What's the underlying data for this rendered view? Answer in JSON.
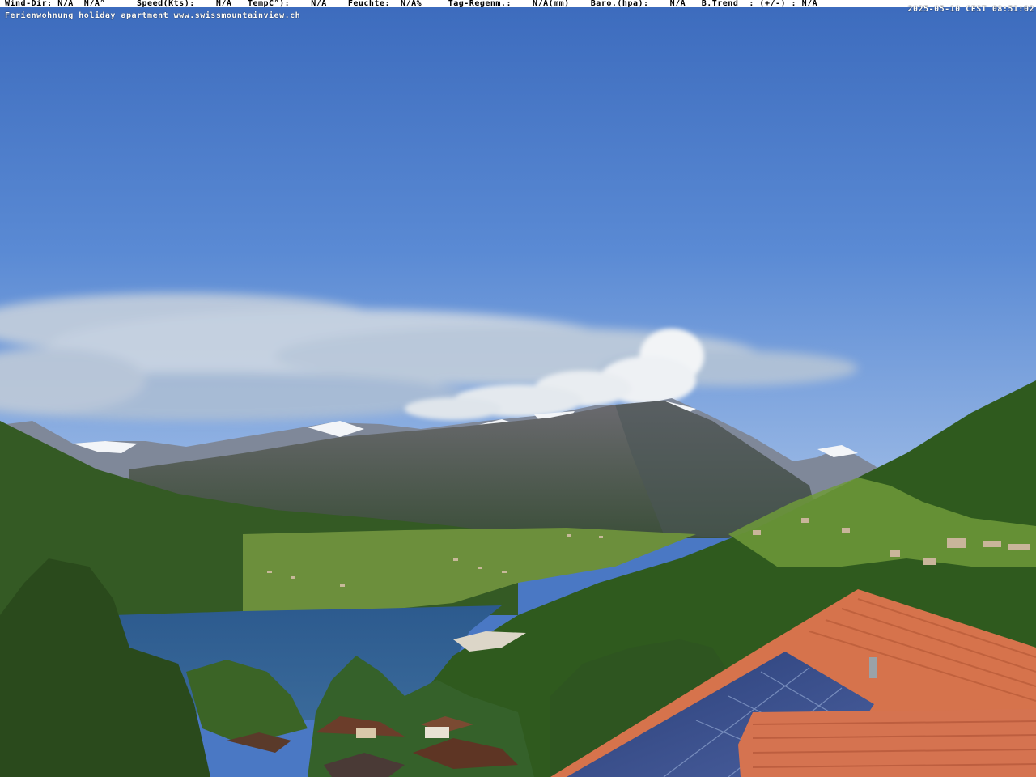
{
  "overlay": {
    "weather_line": "Wind-Dir: N/A  N/A°      Speed(Kts):    N/A   TempC°):    N/A    Feuchte:  N/A%     Tag-Regenm.:    N/A(mm)    Baro.(hpa):    N/A   B.Trend  : (+/-) : N/A",
    "caption": "Ferienwohnung holiday apartment www.swissmountainview.ch",
    "timestamp": "2025-05-10 CEST 08:51:02"
  },
  "colors": {
    "sky_top": "#3f6fc0",
    "sky_horizon": "#8fb4e6",
    "lake": "#2f5c8e",
    "roof_tile": "#d9764f",
    "forest": "#2f5a1e",
    "meadow": "#6f9a3a"
  }
}
